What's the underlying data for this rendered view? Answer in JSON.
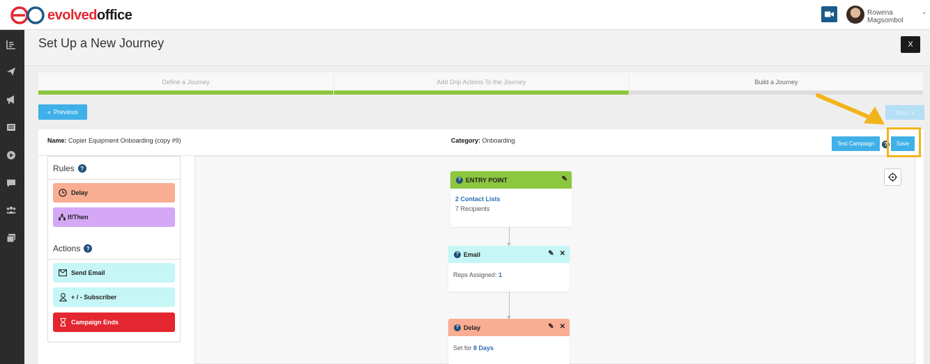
{
  "brand": {
    "name_part1": "evolved",
    "name_part2": "office",
    "accent": "#e3262f"
  },
  "user": {
    "name": "Rowena Magsombol"
  },
  "sidebar": {
    "icons": [
      "reports-icon",
      "send-icon",
      "megaphone-icon",
      "newsletter-icon",
      "play-icon",
      "chat-icon",
      "contacts-icon",
      "gallery-icon"
    ]
  },
  "modal": {
    "title": "Set Up a New Journey",
    "close_label": "X",
    "steps": [
      {
        "label": "Define a Journey"
      },
      {
        "label": "Add Drip Actions To the Journey"
      },
      {
        "label": "Build a Journey"
      }
    ],
    "previous_label": "Previous",
    "next_label": "Next"
  },
  "info": {
    "name_label": "Name:",
    "name_value": "Copier Equipment Onboarding (copy #9)",
    "category_label": "Category:",
    "category_value": "Onboarding",
    "test_label": "Test Campaign",
    "save_label": "Save",
    "help_glyph": "?"
  },
  "rules": {
    "heading": "Rules",
    "items": [
      {
        "label": "Delay",
        "color": "#f9ad92"
      },
      {
        "label": "If/Then",
        "color": "#d4a8f5"
      }
    ]
  },
  "actions": {
    "heading": "Actions",
    "items": [
      {
        "label": "Send Email",
        "color": "#c6f6f6"
      },
      {
        "label": "+ / - Subscriber",
        "color": "#c6f6f6"
      },
      {
        "label": "Campaign Ends",
        "color": "#e3262f"
      }
    ]
  },
  "flow": {
    "entry": {
      "title": "ENTRY POINT",
      "lists": "2 Contact Lists",
      "recipients_num": "7",
      "recipients_label": "Recipients",
      "color": "#8dc63f"
    },
    "email": {
      "title": "Email",
      "reps_label": "Reps Assigned:",
      "reps_value": "1",
      "color": "#c6f6f6"
    },
    "delay": {
      "title": "Delay",
      "set_label": "Set for",
      "set_value": "8 Days",
      "color": "#f9ad92"
    }
  }
}
